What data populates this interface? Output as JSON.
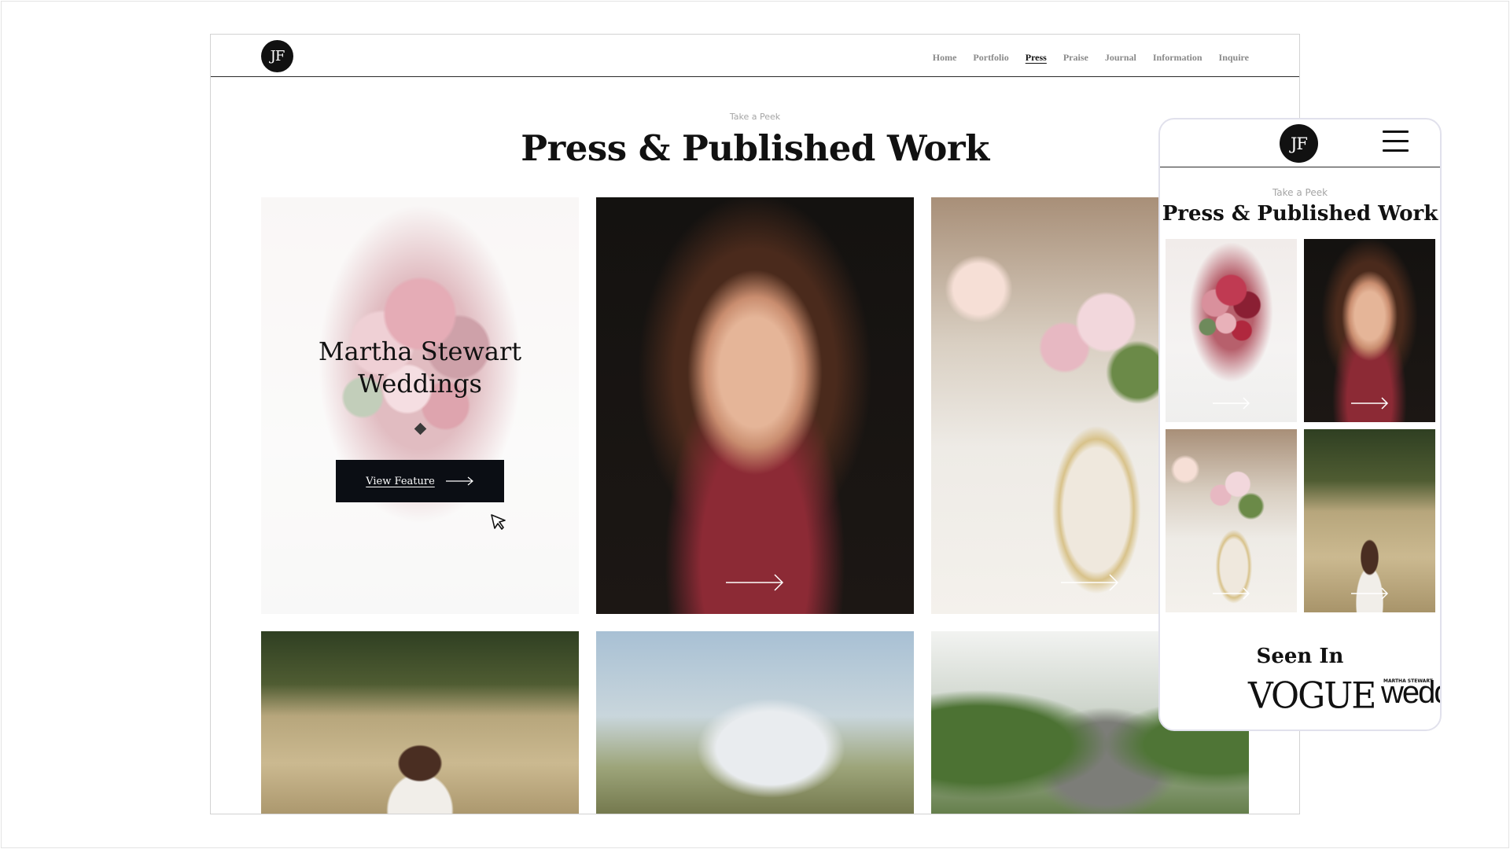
{
  "desktop": {
    "logo_text": "JF",
    "nav": [
      {
        "label": "Home",
        "active": false
      },
      {
        "label": "Portfolio",
        "active": false
      },
      {
        "label": "Press",
        "active": true
      },
      {
        "label": "Praise",
        "active": false
      },
      {
        "label": "Journal",
        "active": false
      },
      {
        "label": "Information",
        "active": false
      },
      {
        "label": "Inquire",
        "active": false
      }
    ],
    "eyebrow": "Take a Peek",
    "title": "Press & Published Work",
    "feature": {
      "title_line1": "Martha Stewart",
      "title_line2": "Weddings",
      "button_label": "View Feature"
    }
  },
  "mobile": {
    "logo_text": "JF",
    "eyebrow": "Take a Peek",
    "title": "Press & Published Work",
    "seen_in_title": "Seen In",
    "logos": {
      "vogue": "VOGUE",
      "msw_small": "MARTHA STEWART",
      "msw_large": "wedd"
    }
  },
  "icons": {
    "arrow": "arrow-right-icon",
    "menu": "hamburger-menu-icon",
    "cursor": "mouse-pointer-icon"
  }
}
